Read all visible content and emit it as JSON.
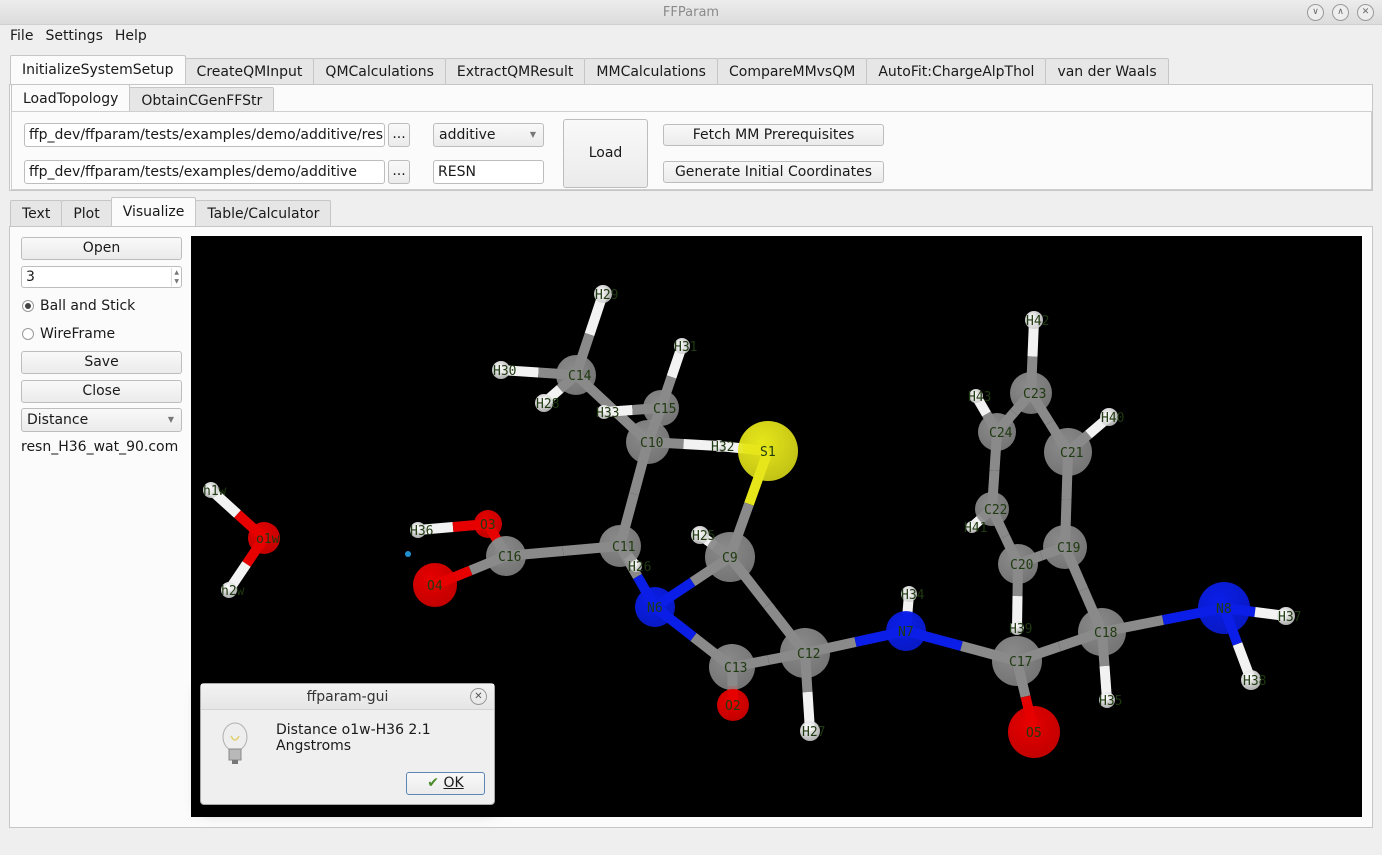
{
  "window": {
    "title": "FFParam",
    "buttons": [
      "minimize",
      "maximize",
      "close"
    ]
  },
  "menu": [
    "File",
    "Settings",
    "Help"
  ],
  "main_tabs": [
    {
      "label": "InitializeSystemSetup",
      "active": true
    },
    {
      "label": "CreateQMInput"
    },
    {
      "label": "QMCalculations"
    },
    {
      "label": "ExtractQMResult"
    },
    {
      "label": "MMCalculations"
    },
    {
      "label": "CompareMMvsQM"
    },
    {
      "label": "AutoFit:ChargeAlpThol"
    },
    {
      "label": "van der Waals"
    }
  ],
  "sub_tabs": [
    {
      "label": "LoadTopology",
      "active": true
    },
    {
      "label": "ObtainCGenFFStr"
    }
  ],
  "load_topology": {
    "topology_path": "ffp_dev/ffparam/tests/examples/demo/additive/resn.str",
    "directory_path": "ffp_dev/ffparam/tests/examples/demo/additive",
    "browse_label": "...",
    "forcefield_select": "additive",
    "resname": "RESN",
    "load_label": "Load",
    "fetch_label": "Fetch MM Prerequisites",
    "generate_label": "Generate Initial Coordinates"
  },
  "output_tabs": [
    {
      "label": "Text"
    },
    {
      "label": "Plot"
    },
    {
      "label": "Visualize",
      "active": true
    },
    {
      "label": "Table/Calculator"
    }
  ],
  "visualize": {
    "open_label": "Open",
    "spin_value": "3",
    "render_modes": [
      {
        "label": "Ball and Stick",
        "selected": true
      },
      {
        "label": "WireFrame",
        "selected": false
      }
    ],
    "save_label": "Save",
    "close_label": "Close",
    "measure_select": "Distance",
    "filename": "resn_H36_wat_90.com"
  },
  "atom_colors": {
    "C": "#8a8a8a",
    "H": "#f2f2f2",
    "O": "#e60000",
    "N": "#0a1ee8",
    "S": "#e6e61a"
  },
  "atoms": [
    {
      "id": "h1w",
      "el": "H"
    },
    {
      "id": "o1w",
      "el": "O"
    },
    {
      "id": "h2w",
      "el": "H"
    },
    {
      "id": "H36",
      "el": "H"
    },
    {
      "id": "O3",
      "el": "O"
    },
    {
      "id": "C16",
      "el": "C"
    },
    {
      "id": "O4",
      "el": "O"
    },
    {
      "id": "H29",
      "el": "H"
    },
    {
      "id": "H30",
      "el": "H"
    },
    {
      "id": "C14",
      "el": "C"
    },
    {
      "id": "H28",
      "el": "H"
    },
    {
      "id": "H31",
      "el": "H"
    },
    {
      "id": "H33",
      "el": "H"
    },
    {
      "id": "C15",
      "el": "C"
    },
    {
      "id": "C10",
      "el": "C"
    },
    {
      "id": "H32",
      "el": "H"
    },
    {
      "id": "S1",
      "el": "S"
    },
    {
      "id": "C11",
      "el": "C"
    },
    {
      "id": "H26",
      "el": "H"
    },
    {
      "id": "H25",
      "el": "H"
    },
    {
      "id": "C9",
      "el": "C"
    },
    {
      "id": "N6",
      "el": "N"
    },
    {
      "id": "C13",
      "el": "C"
    },
    {
      "id": "O2",
      "el": "O"
    },
    {
      "id": "C12",
      "el": "C"
    },
    {
      "id": "H27",
      "el": "H"
    },
    {
      "id": "N7",
      "el": "N"
    },
    {
      "id": "H34",
      "el": "H"
    },
    {
      "id": "C17",
      "el": "C"
    },
    {
      "id": "O5",
      "el": "O"
    },
    {
      "id": "C20",
      "el": "C"
    },
    {
      "id": "H39",
      "el": "H"
    },
    {
      "id": "C19",
      "el": "C"
    },
    {
      "id": "C18",
      "el": "C"
    },
    {
      "id": "H35",
      "el": "H"
    },
    {
      "id": "N8",
      "el": "N"
    },
    {
      "id": "H37",
      "el": "H"
    },
    {
      "id": "H38",
      "el": "H"
    },
    {
      "id": "C22",
      "el": "C"
    },
    {
      "id": "H41",
      "el": "H"
    },
    {
      "id": "C24",
      "el": "C"
    },
    {
      "id": "H43",
      "el": "H"
    },
    {
      "id": "C23",
      "el": "C"
    },
    {
      "id": "H42",
      "el": "H"
    },
    {
      "id": "C21",
      "el": "C"
    },
    {
      "id": "H40",
      "el": "H"
    }
  ],
  "dialog": {
    "title": "ffparam-gui",
    "message": "Distance o1w-H36 2.1 Angstroms",
    "ok_label": "OK"
  }
}
